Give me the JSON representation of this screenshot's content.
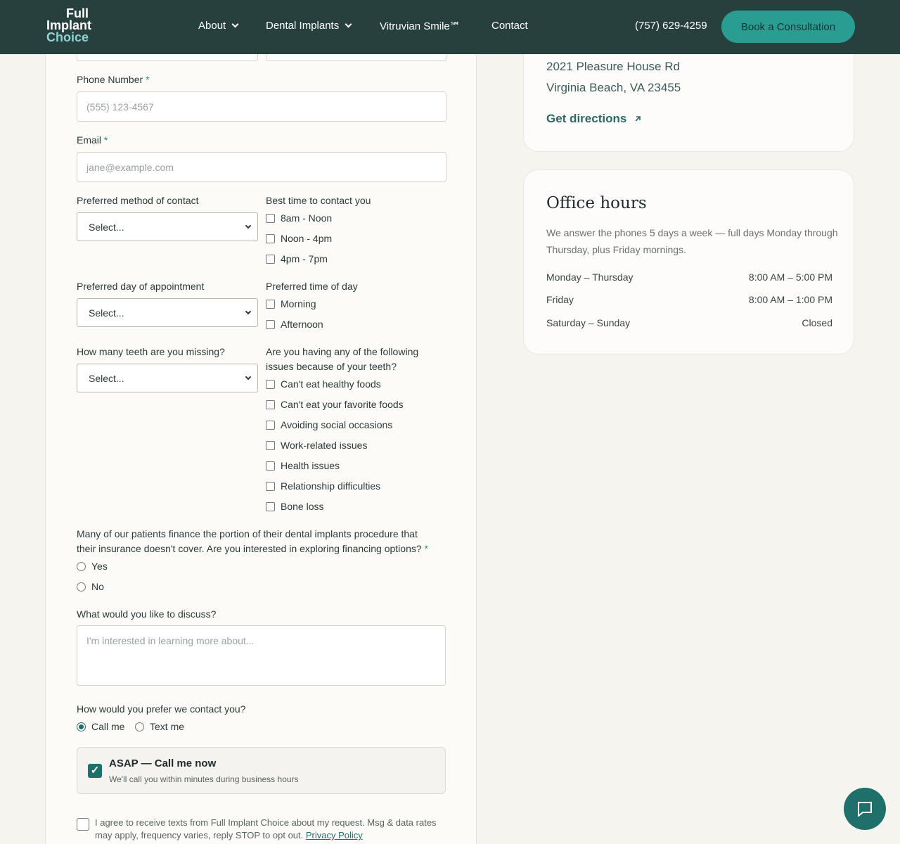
{
  "header": {
    "logo": [
      "Full",
      "Implant",
      "Choice"
    ],
    "nav": {
      "about": "About",
      "implants": "Dental Implants",
      "vitruvian": "Vitruvian Smile℠",
      "contact": "Contact"
    },
    "phone": "(757) 629-4259",
    "cta": "Book a Consultation"
  },
  "form": {
    "phone_label": "Phone Number",
    "phone_placeholder": "(555) 123-4567",
    "email_label": "Email",
    "email_placeholder": "jane@example.com",
    "required_mark": "*",
    "contact_method_label": "Preferred method of contact",
    "contact_method_value": "Select...",
    "best_time_label": "Best time to contact you",
    "best_time_options": [
      "8am - Noon",
      "Noon - 4pm",
      "4pm - 7pm"
    ],
    "pref_day_label": "Preferred day of appointment",
    "pref_day_value": "Select...",
    "pref_time_label": "Preferred time of day",
    "pref_time_options": [
      "Morning",
      "Afternoon"
    ],
    "teeth_label": "How many teeth are you missing?",
    "teeth_value": "Select...",
    "issues_label_1": "Are you having any of the following",
    "issues_label_2": "issues because of your teeth?",
    "issues_options": [
      "Can't eat healthy foods",
      "Can't eat your favorite foods",
      "Avoiding social occasions",
      "Work-related issues",
      "Health issues",
      "Relationship difficulties",
      "Bone loss"
    ],
    "financing_q_1": "Many of our patients finance the portion of their dental implants procedure that",
    "financing_q_2": "their insurance doesn't cover. Are you interested in exploring financing options?",
    "financing_options": [
      "Yes",
      "No"
    ],
    "discuss_label": "What would you like to discuss?",
    "discuss_placeholder": "I'm interested in learning more about...",
    "prefer_label": "How would you prefer we contact you?",
    "prefer_options": [
      "Call me",
      "Text me"
    ],
    "asap_title": "ASAP — Call me now",
    "asap_sub": "We'll call you within minutes during business hours",
    "consent_text": "I agree to receive texts from Full Implant Choice about my request. Msg & data rates may apply, frequency varies, reply STOP to opt out.",
    "privacy_link": "Privacy Policy"
  },
  "location": {
    "street": "2021 Pleasure House Rd",
    "city": "Virginia Beach, VA 23455",
    "directions": "Get directions"
  },
  "hours": {
    "title": "Office hours",
    "desc": "We answer the phones 5 days a week — full days Monday through Thursday, plus Friday mornings.",
    "rows": [
      {
        "day": "Monday – Thursday",
        "time": "8:00 AM – 5:00 PM"
      },
      {
        "day": "Friday",
        "time": "8:00 AM – 1:00 PM"
      },
      {
        "day": "Saturday – Sunday",
        "time": "Closed"
      }
    ]
  }
}
